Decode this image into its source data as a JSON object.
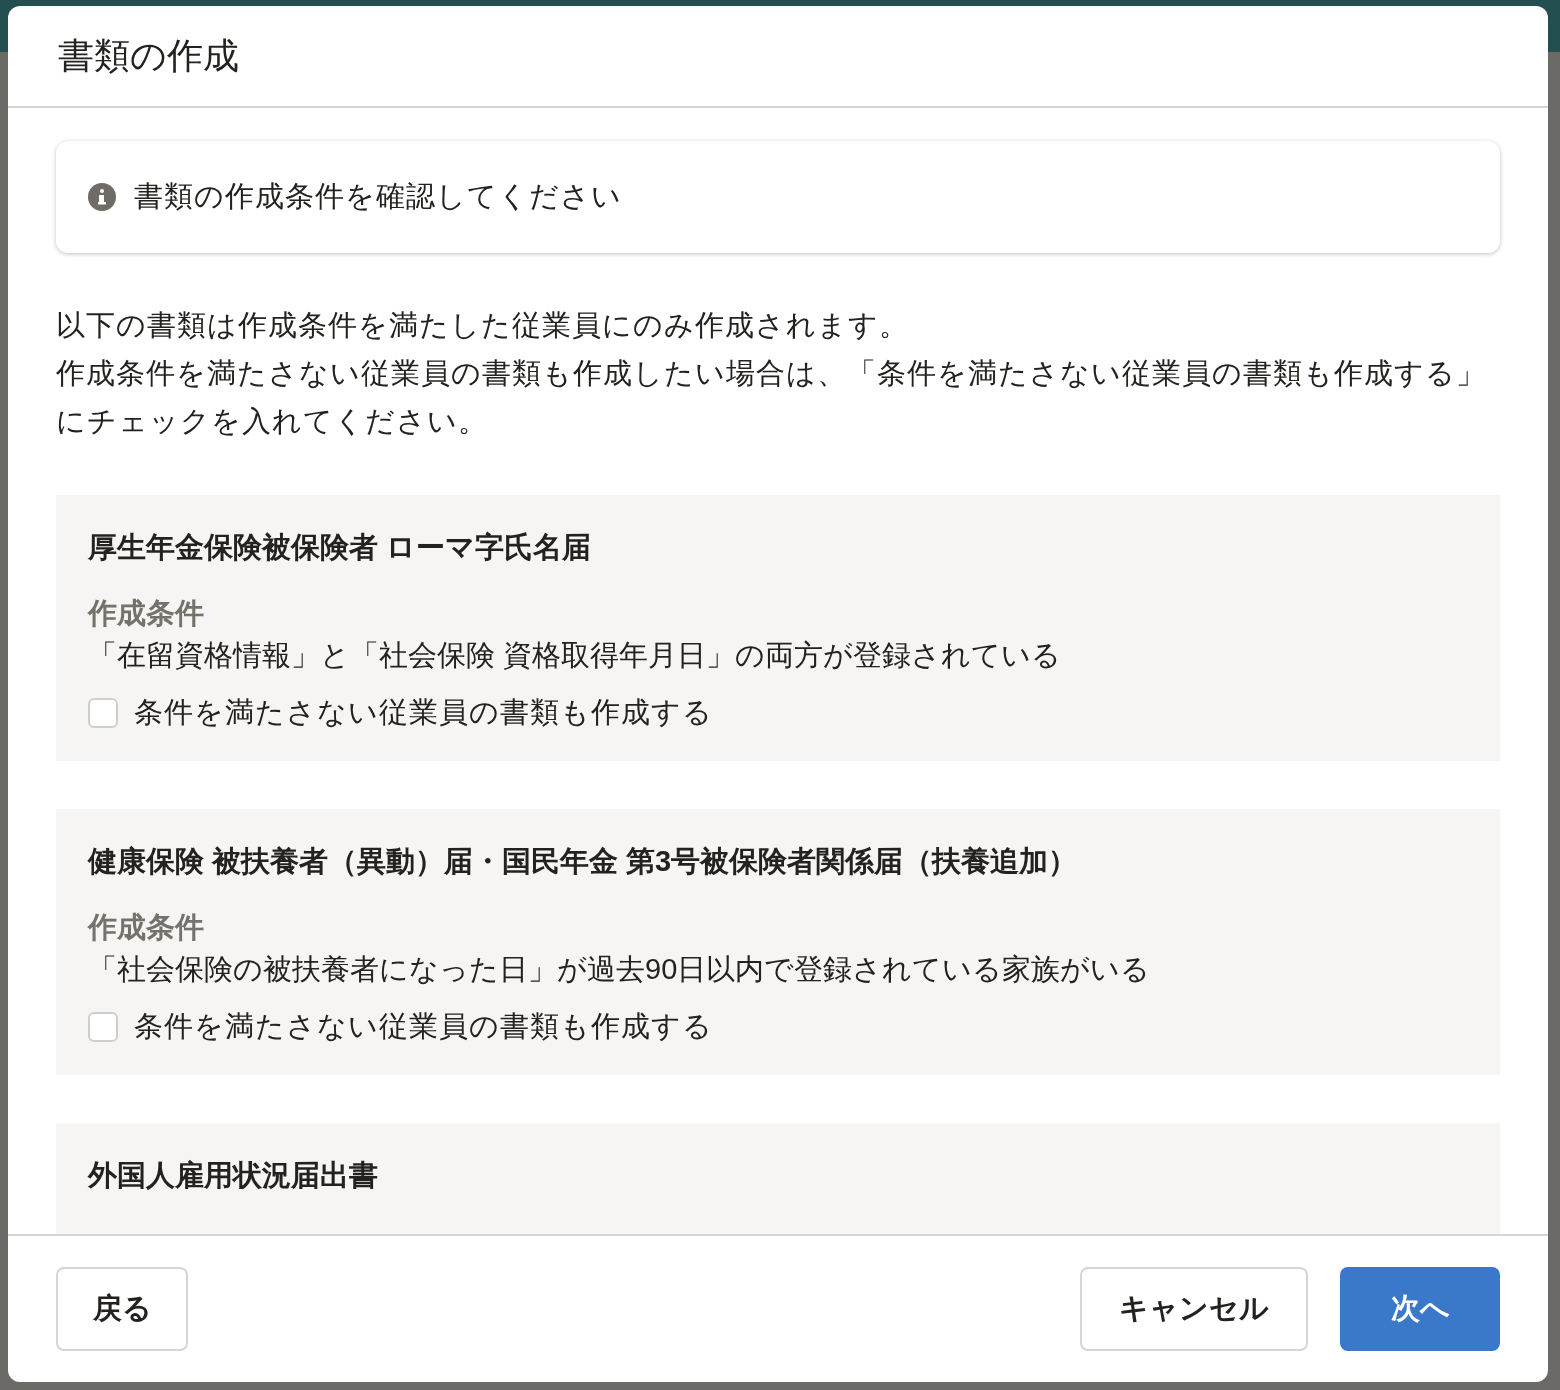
{
  "dialog": {
    "title": "書類の作成"
  },
  "notice": {
    "text": "書類の作成条件を確認してください"
  },
  "description": [
    "以下の書類は作成条件を満たした従業員にのみ作成されます。",
    "作成条件を満たさない従業員の書類も作成したい場合は、「条件を満たさない従業員の書類も作成する」にチェックを入れてください。"
  ],
  "documents": [
    {
      "title": "厚生年金保険被保険者 ローマ字氏名届",
      "condition_label": "作成条件",
      "condition": "「在留資格情報」と「社会保険 資格取得年月日」の両方が登録されている",
      "checkbox": {
        "label": "条件を満たさない従業員の書類も作成する",
        "checked": false
      }
    },
    {
      "title": "健康保険 被扶養者（異動）届・国民年金 第3号被保険者関係届（扶養追加）",
      "condition_label": "作成条件",
      "condition": "「社会保険の被扶養者になった日」が過去90日以内で登録されている家族がいる",
      "checkbox": {
        "label": "条件を満たさない従業員の書類も作成する",
        "checked": false
      }
    },
    {
      "title": "外国人雇用状況届出書"
    }
  ],
  "footer": {
    "back_button": "戻る",
    "cancel_button": "キャンセル",
    "next_button": "次へ"
  }
}
